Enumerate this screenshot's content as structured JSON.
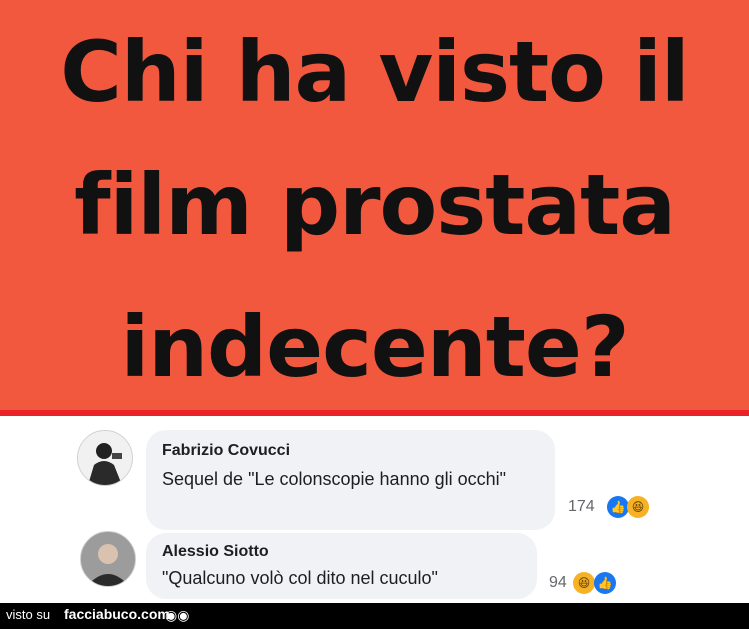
{
  "headline": {
    "line1": "Chi ha visto il",
    "line2": "film prostata",
    "line3": "indecente?"
  },
  "comments": [
    {
      "author": "Fabrizio Covucci",
      "text": "Sequel de \"Le colonscopie hanno gli occhi\"",
      "count": "174",
      "reactions": [
        "like-icon",
        "haha-icon"
      ]
    },
    {
      "author": "Alessio Siotto",
      "text": "\"Qualcuno volò col dito nel cuculo\"",
      "count": "94",
      "reactions": [
        "haha-icon",
        "like-icon"
      ]
    }
  ],
  "footer": {
    "prefix": "visto su",
    "site": "facciabuco.com",
    "eyes": "◉◉"
  },
  "colors": {
    "banner": "#f2583e",
    "banner_line": "#e8242a",
    "like": "#1877f2",
    "haha": "#f7b125"
  }
}
